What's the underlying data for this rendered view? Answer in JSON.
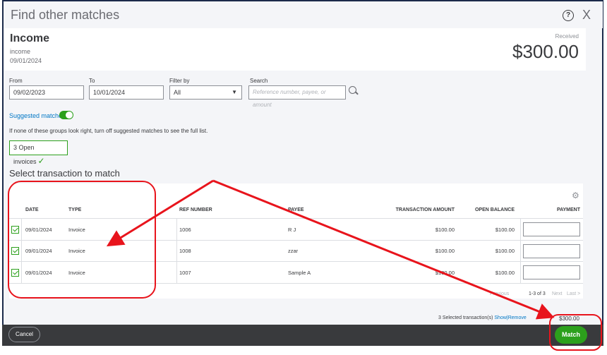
{
  "dialog": {
    "title": "Find other matches",
    "help_icon": "help-icon",
    "close_label": "X"
  },
  "header": {
    "name": "Income",
    "subname": "income",
    "date": "09/01/2024",
    "received_label": "Received",
    "amount": "$300.00"
  },
  "filters": {
    "from_label": "From",
    "from_value": "09/02/2023",
    "to_label": "To",
    "to_value": "10/01/2024",
    "filter_label": "Filter by",
    "filter_value": "All",
    "search_label": "Search",
    "search_placeholder": "Reference number, payee, or amount"
  },
  "suggested": {
    "label": "Suggested matches",
    "enabled": true,
    "hint": "If none of these groups look right, turn off suggested matches to see the full list.",
    "chip_label": "3 Open invoices"
  },
  "table": {
    "section_title": "Select transaction to match",
    "columns": [
      "DATE",
      "TYPE",
      "REF NUMBER",
      "PAYEE",
      "TRANSACTION AMOUNT",
      "OPEN BALANCE",
      "PAYMENT"
    ],
    "rows": [
      {
        "date": "09/01/2024",
        "type": "Invoice",
        "ref": "1006",
        "payee": "R J",
        "amount": "$100.00",
        "balance": "$100.00",
        "payment": "",
        "checked": true
      },
      {
        "date": "09/01/2024",
        "type": "Invoice",
        "ref": "1008",
        "payee": "zzar",
        "amount": "$100.00",
        "balance": "$100.00",
        "payment": "",
        "checked": true
      },
      {
        "date": "09/01/2024",
        "type": "Invoice",
        "ref": "1007",
        "payee": "Sample A",
        "amount": "$100.00",
        "balance": "$100.00",
        "payment": "",
        "checked": true
      }
    ],
    "pager": {
      "first": "First",
      "previous": "Previous",
      "range": "1-3 of 3",
      "next": "Next",
      "last": "Last >"
    }
  },
  "summary": {
    "selected": "3 Selected transaction(s)",
    "show": "Show",
    "separator": "|",
    "remove": "Remove",
    "total": "$300.00"
  },
  "footer": {
    "cancel_label": "Cancel",
    "match_label": "Match"
  },
  "colors": {
    "accent_green": "#2ca01c",
    "link_blue": "#0077c5",
    "footer_bg": "#393a3d",
    "annotation_red": "#e8141c"
  }
}
